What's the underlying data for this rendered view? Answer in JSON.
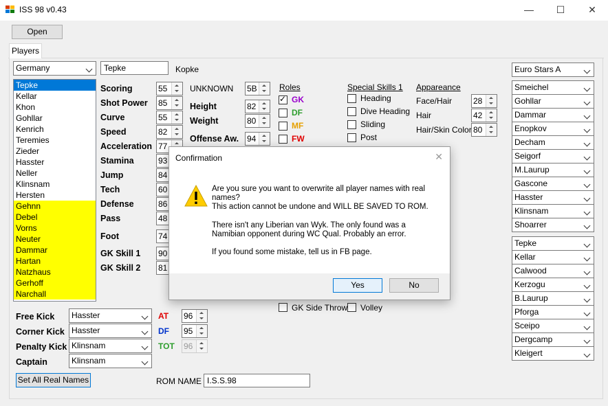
{
  "window": {
    "title": "ISS 98 v0.43",
    "controls": [
      "—",
      "☐",
      "✕"
    ]
  },
  "toolbar": {
    "open_label": "Open"
  },
  "tabs": [
    {
      "label": "Players"
    }
  ],
  "team_select": "Germany",
  "player_name": "Tepke",
  "real_name": "Kopke",
  "players": [
    {
      "name": "Tepke",
      "state": "selected"
    },
    {
      "name": "Kellar",
      "state": "normal"
    },
    {
      "name": "Khon",
      "state": "normal"
    },
    {
      "name": "Gohllar",
      "state": "normal"
    },
    {
      "name": "Kenrich",
      "state": "normal"
    },
    {
      "name": "Teremies",
      "state": "normal"
    },
    {
      "name": "Zieder",
      "state": "normal"
    },
    {
      "name": "Hasster",
      "state": "normal"
    },
    {
      "name": "Neller",
      "state": "normal"
    },
    {
      "name": "Klinsnam",
      "state": "normal"
    },
    {
      "name": "Hersten",
      "state": "normal"
    },
    {
      "name": "Gehnn",
      "state": "highlight"
    },
    {
      "name": "Debel",
      "state": "highlight"
    },
    {
      "name": "Vorns",
      "state": "highlight"
    },
    {
      "name": "Neuter",
      "state": "highlight"
    },
    {
      "name": "Dammar",
      "state": "highlight"
    },
    {
      "name": "Hartan",
      "state": "highlight"
    },
    {
      "name": "Natzhaus",
      "state": "highlight"
    },
    {
      "name": "Gerhoff",
      "state": "highlight"
    },
    {
      "name": "Narchall",
      "state": "highlight"
    }
  ],
  "stats": [
    {
      "label": "Scoring",
      "value": "55"
    },
    {
      "label": "Shot Power",
      "value": "85"
    },
    {
      "label": "Curve",
      "value": "55"
    },
    {
      "label": "Speed",
      "value": "82"
    },
    {
      "label": "Acceleration",
      "value": "77"
    },
    {
      "label": "Stamina",
      "value": "93"
    },
    {
      "label": "Jump",
      "value": "84"
    },
    {
      "label": "Tech",
      "value": "60"
    },
    {
      "label": "Defense",
      "value": "86"
    },
    {
      "label": "Pass",
      "value": "48"
    },
    {
      "label": "Foot",
      "value": "74"
    },
    {
      "label": "GK Skill 1",
      "value": "90"
    },
    {
      "label": "GK Skill 2",
      "value": "81"
    }
  ],
  "physical": {
    "unknown_label": "UNKNOWN",
    "unknown_value": "5B",
    "height_label": "Height",
    "height_value": "82",
    "weight_label": "Weight",
    "weight_value": "80",
    "offense_label": "Offense Aw.",
    "offense_value": "94"
  },
  "roles": {
    "header": "Roles",
    "items": [
      {
        "label": "GK",
        "checked": true,
        "color": "#9900cc"
      },
      {
        "label": "DF",
        "checked": false,
        "color": "#2e9e2e"
      },
      {
        "label": "MF",
        "checked": false,
        "color": "#e6a000"
      },
      {
        "label": "FW",
        "checked": false,
        "color": "#e00000"
      }
    ]
  },
  "special_skills": {
    "header": "Special Skills 1",
    "items": [
      "Heading",
      "Dive Heading",
      "Sliding",
      "Post"
    ],
    "bottom": [
      "GK Side Throw",
      "Volley"
    ]
  },
  "appearance": {
    "header": "Appareance",
    "items": [
      {
        "label": "Face/Hair",
        "value": "28"
      },
      {
        "label": "Hair",
        "value": "42"
      },
      {
        "label": "Hair/Skin Color",
        "value": "80"
      }
    ]
  },
  "set_pieces": [
    {
      "label": "Free Kick",
      "value": "Hasster"
    },
    {
      "label": "Corner Kick",
      "value": "Hasster"
    },
    {
      "label": "Penalty Kick",
      "value": "Klinsnam"
    },
    {
      "label": "Captain",
      "value": "Klinsnam"
    }
  ],
  "team_ratings": [
    {
      "label": "AT",
      "value": "96",
      "color": "#e00000",
      "disabled": false
    },
    {
      "label": "DF",
      "value": "95",
      "color": "#0033cc",
      "disabled": false
    },
    {
      "label": "TOT",
      "value": "96",
      "color": "#2e9e2e",
      "disabled": true
    }
  ],
  "set_real_names_label": "Set All Real Names",
  "rom_name": {
    "label": "ROM NAME",
    "value": "I.S.S.98"
  },
  "right_panel": {
    "team": "Euro Stars A",
    "group1": [
      "Smeichel",
      "Gohllar",
      "Dammar",
      "Enopkov",
      "Decham",
      "Seigorf",
      "M.Laurup",
      "Gascone",
      "Hasster",
      "Klinsnam",
      "Shoarrer"
    ],
    "group2": [
      "Tepke",
      "Kellar",
      "Calwood",
      "Kerzogu",
      "B.Laurup",
      "Pforga",
      "Sceipo",
      "Dergcamp",
      "Kleigert"
    ]
  },
  "dialog": {
    "title": "Confirmation",
    "close": "✕",
    "message": "Are you sure you want to overwrite all player names with real\nnames?\nThis action cannot be undone and WILL BE SAVED TO ROM.\n\nThere isn't any Liberian van Wyk. The only found was a\nNamibian opponent during WC Qual. Probably an error.\n\nIf you found some mistake, tell us in FB page.",
    "yes": "Yes",
    "no": "No"
  }
}
